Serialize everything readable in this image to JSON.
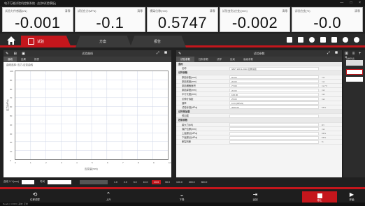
{
  "window": {
    "title": "电子万能试验机控制系统 - [拉伸试验模板]",
    "buttons": [
      "—",
      "□",
      "×"
    ]
  },
  "readouts": [
    {
      "label": "试验力传感器(kN)",
      "button": "清零",
      "value": "-0.001"
    },
    {
      "label": "试验应力(MPa)",
      "button": "清零",
      "value": "-0.1"
    },
    {
      "label": "横梁位移(mm)",
      "button": "清零",
      "value": "0.5747"
    },
    {
      "label": "试验变形(应变)(mm)",
      "button": "清零",
      "value": "-0.002"
    },
    {
      "label": "试验应变(%)",
      "button": "清零",
      "value": "-0.0"
    }
  ],
  "nav": {
    "tabs": [
      {
        "label": "试验",
        "active": true
      },
      {
        "label": "方案",
        "active": false
      },
      {
        "label": "报告",
        "active": false
      }
    ],
    "icons": [
      "print-icon",
      "save-icon",
      "camera-icon",
      "video-icon",
      "monitor-icon",
      "settings-icon",
      "info-icon"
    ]
  },
  "left_panel": {
    "title": "试验曲线",
    "tools": "✎ ⊞ ▣",
    "subtabs": [
      "曲线",
      "结果",
      "报表"
    ],
    "caption": "曲线选择: 应力-应变曲线",
    "ylabel": "应力(MPa)",
    "xlabel": "应变量(mm)",
    "yticks": [
      "100",
      "90",
      "80",
      "70",
      "60",
      "50",
      "40",
      "30",
      "20",
      "10",
      "0"
    ],
    "xticks": [
      "0",
      "1",
      "2",
      "3",
      "4",
      "5",
      "6",
      "7",
      "8",
      "9",
      "10"
    ]
  },
  "right_panel": {
    "title": "试验参数",
    "subtabs": [
      "试验参数",
      "控制参数",
      "试样",
      "结束",
      "高级参数"
    ],
    "rows": [
      {
        "group": true,
        "key": "通用"
      },
      {
        "key": "名称",
        "value": "GB/T 228.1-2010 拉伸试验",
        "unit": ""
      },
      {
        "group": true,
        "key": "试样参数"
      },
      {
        "key": "原始标距(mm)",
        "value": "50.00",
        "unit": "mm"
      },
      {
        "key": "原始宽度(mm)",
        "value": "20.00",
        "unit": "mm"
      },
      {
        "key": "原始横截面积",
        "value": "77.00",
        "unit": "mm^2"
      },
      {
        "key": "原始厚度(mm)",
        "value": "20.00",
        "unit": "mm"
      },
      {
        "key": "平行长度(mm)",
        "value": "100.00",
        "unit": "mm"
      },
      {
        "key": "引伸计标距",
        "value": "25.00",
        "unit": "mm"
      },
      {
        "key": "速率",
        "value": "10.0 (MPa/s)",
        "unit": ""
      },
      {
        "key": "试验标准(MPa)",
        "value": "3000.00",
        "unit": "MPa"
      },
      {
        "group": true,
        "key": "试样预加载"
      },
      {
        "key": "预加载",
        "value": "",
        "unit": ""
      },
      {
        "group": true,
        "key": "控制参数"
      },
      {
        "key": "最大力(kN)",
        "value": "",
        "unit": "kN"
      },
      {
        "key": "保护位移(mm)",
        "value": "",
        "unit": "mm"
      },
      {
        "key": "上屈服点(MPa)",
        "value": "",
        "unit": "MPa"
      },
      {
        "key": "下屈服点(MPa)",
        "value": "",
        "unit": "MPa"
      },
      {
        "key": "断裂判断",
        "value": "",
        "unit": "%"
      }
    ]
  },
  "strip": {
    "tools": "⊞ ≡ + ×",
    "title": "试样列表"
  },
  "filters": {
    "label1": "曲线 X-Y(mm)",
    "label2": "时间",
    "chips": [
      {
        "label": "1.0",
        "on": false
      },
      {
        "label": "2.0",
        "on": false
      },
      {
        "label": "5.0",
        "on": false
      },
      {
        "label": "10.0",
        "on": false
      },
      {
        "label": "20.0",
        "on": true
      },
      {
        "label": "50.0",
        "on": false
      },
      {
        "label": "100.0",
        "on": false
      },
      {
        "label": "200.0",
        "on": false
      },
      {
        "label": "500.0",
        "on": false
      }
    ]
  },
  "toolbar": {
    "buttons": [
      {
        "glyph": "⟲",
        "label": "位移调零"
      },
      {
        "glyph": "⌃",
        "label": "上升"
      },
      {
        "glyph": "⌄",
        "label": "下降"
      },
      {
        "glyph": "⇥",
        "label": "返回"
      }
    ],
    "stop": "停止",
    "next": "开始"
  },
  "status": {
    "text": "Ready  |  COM3  |  系统: 正常"
  }
}
